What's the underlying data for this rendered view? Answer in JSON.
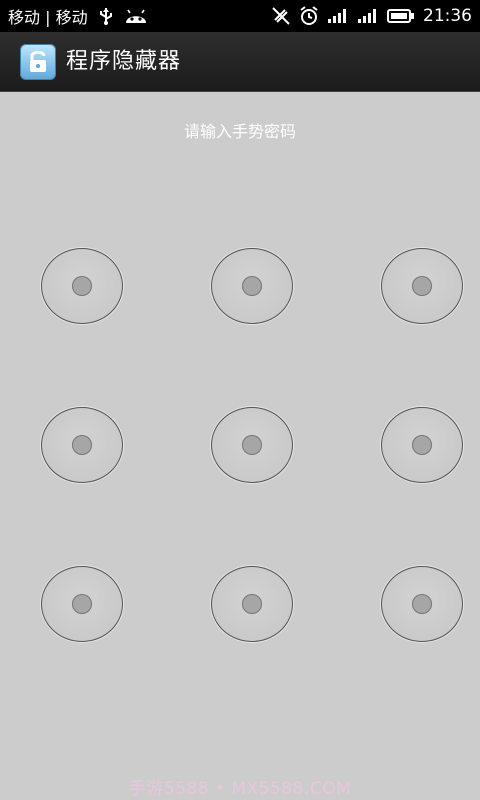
{
  "status_bar": {
    "carrier": "移动 | 移动",
    "time": "21:36",
    "icons": [
      "usb-icon",
      "android-icon",
      "vibrate-icon",
      "alarm-icon",
      "signal-icon",
      "signal-icon",
      "battery-icon"
    ]
  },
  "action_bar": {
    "title": "程序隐藏器",
    "icon": "lock-icon"
  },
  "main": {
    "prompt": "请输入手势密码",
    "pattern_nodes": 9
  },
  "watermark": {
    "text": "手游5588 • MX5588.COM"
  },
  "colors": {
    "background": "#cccccc",
    "action_bar": "#222222",
    "status_bar": "#000000",
    "watermark": "#e8c6dd"
  }
}
